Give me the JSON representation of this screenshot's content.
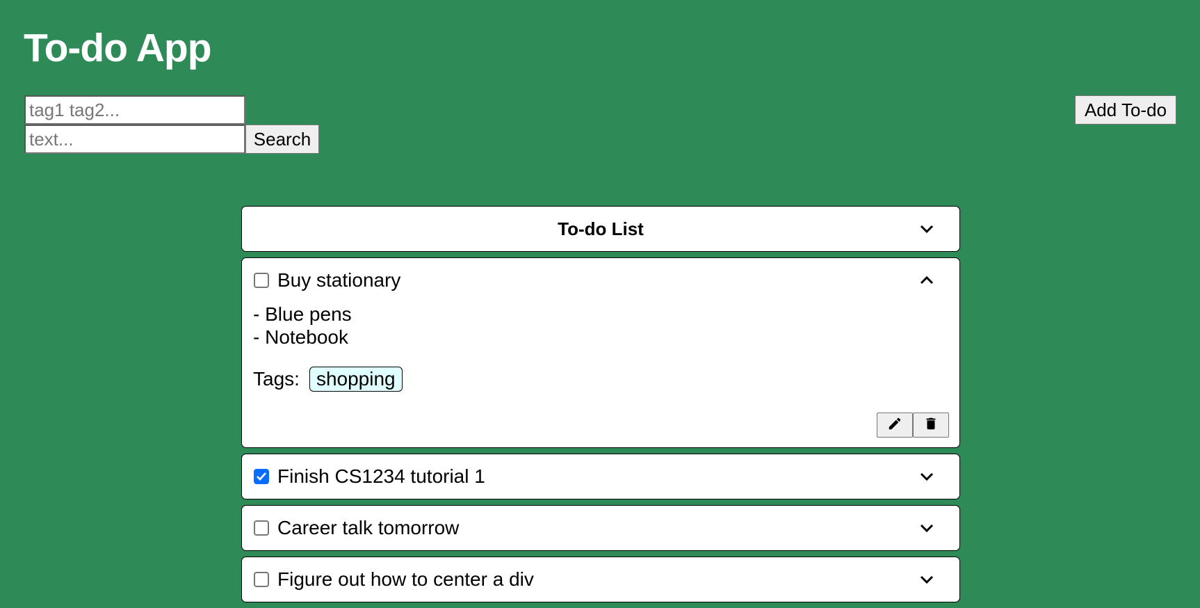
{
  "app": {
    "title": "To-do App"
  },
  "search": {
    "tags_placeholder": "tag1 tag2...",
    "tags_value": "",
    "text_placeholder": "text...",
    "text_value": "",
    "button_label": "Search"
  },
  "toolbar": {
    "add_label": "Add To-do"
  },
  "list": {
    "title": "To-do List",
    "expanded": true,
    "items": [
      {
        "title": "Buy stationary",
        "checked": false,
        "expanded": true,
        "description": [
          "- Blue pens",
          "- Notebook"
        ],
        "tags_label": "Tags:",
        "tags": [
          "shopping"
        ],
        "actions": [
          "pencil-icon",
          "trash-icon"
        ]
      },
      {
        "title": "Finish CS1234 tutorial 1",
        "checked": true,
        "expanded": false
      },
      {
        "title": "Career talk tomorrow",
        "checked": false,
        "expanded": false
      },
      {
        "title": "Figure out how to center a div",
        "checked": false,
        "expanded": false
      }
    ]
  },
  "colors": {
    "background": "#2e8b57",
    "tag_background": "#e0ffff",
    "checkbox_checked": "#0a6cff"
  }
}
